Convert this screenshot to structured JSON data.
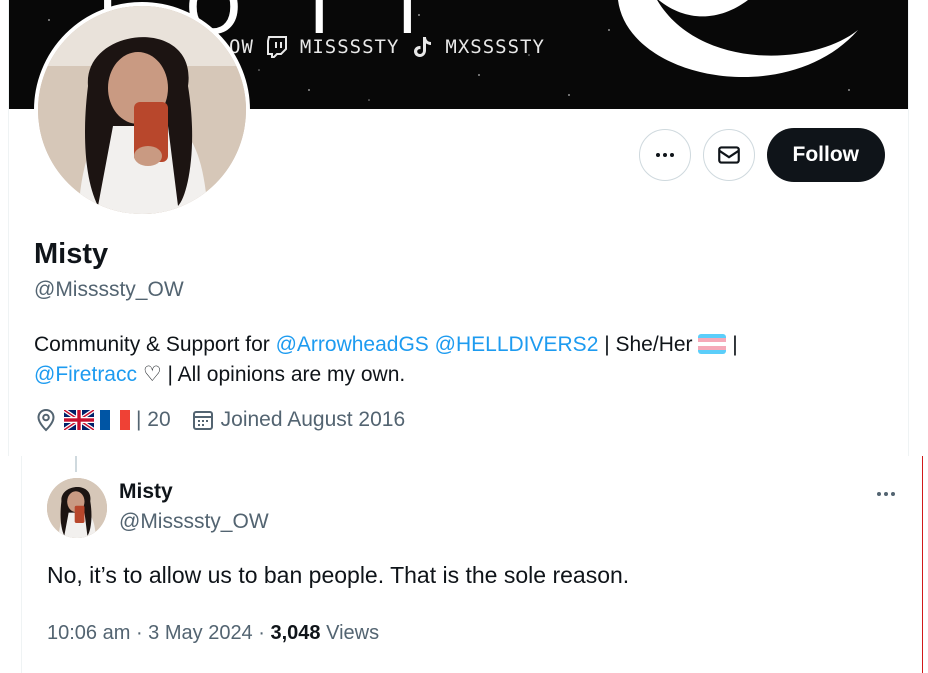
{
  "banner": {
    "top_glyphs": "I O I I",
    "socials": [
      {
        "icon": "overwatch-icon",
        "text": "OW"
      },
      {
        "icon": "twitch-icon",
        "text": "MISSSSTY"
      },
      {
        "icon": "tiktok-icon",
        "text": "MXSSSSTY"
      }
    ]
  },
  "profile": {
    "display_name": "Misty",
    "handle": "@Missssty_OW",
    "follow_label": "Follow",
    "bio": {
      "prefix": "Community & Support for ",
      "mention_1": "@ArrowheadGS",
      "mention_2": "@HELLDIVERS2",
      "mid": " | She/Her ",
      "after_flag": " |",
      "mention_3": "@Firetracc",
      "suffix": " ♡ | All opinions are my own."
    },
    "location_suffix": "| 20",
    "joined": "Joined August 2016"
  },
  "tweet": {
    "name": "Misty",
    "handle": "@Missssty_OW",
    "text": "No, it’s to allow us to ban people. That is the sole reason.",
    "time": "10:06 am",
    "date": "3 May 2024",
    "views_count": "3,048",
    "views_label": "Views"
  },
  "colors": {
    "link": "#1d9bf0",
    "text": "#0f1419",
    "secondary": "#536471",
    "follow_bg": "#0f1419"
  }
}
